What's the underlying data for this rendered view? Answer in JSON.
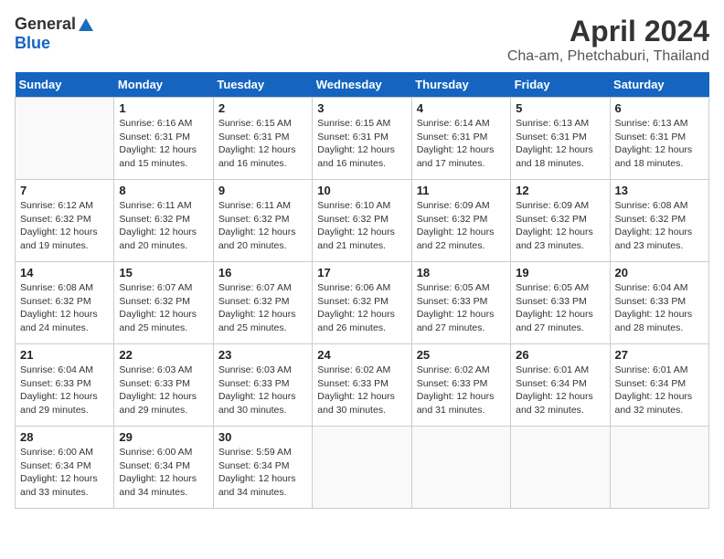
{
  "logo": {
    "general": "General",
    "blue": "Blue"
  },
  "title": "April 2024",
  "subtitle": "Cha-am, Phetchaburi, Thailand",
  "days_of_week": [
    "Sunday",
    "Monday",
    "Tuesday",
    "Wednesday",
    "Thursday",
    "Friday",
    "Saturday"
  ],
  "weeks": [
    [
      {
        "num": "",
        "info": ""
      },
      {
        "num": "1",
        "info": "Sunrise: 6:16 AM\nSunset: 6:31 PM\nDaylight: 12 hours\nand 15 minutes."
      },
      {
        "num": "2",
        "info": "Sunrise: 6:15 AM\nSunset: 6:31 PM\nDaylight: 12 hours\nand 16 minutes."
      },
      {
        "num": "3",
        "info": "Sunrise: 6:15 AM\nSunset: 6:31 PM\nDaylight: 12 hours\nand 16 minutes."
      },
      {
        "num": "4",
        "info": "Sunrise: 6:14 AM\nSunset: 6:31 PM\nDaylight: 12 hours\nand 17 minutes."
      },
      {
        "num": "5",
        "info": "Sunrise: 6:13 AM\nSunset: 6:31 PM\nDaylight: 12 hours\nand 18 minutes."
      },
      {
        "num": "6",
        "info": "Sunrise: 6:13 AM\nSunset: 6:31 PM\nDaylight: 12 hours\nand 18 minutes."
      }
    ],
    [
      {
        "num": "7",
        "info": "Sunrise: 6:12 AM\nSunset: 6:32 PM\nDaylight: 12 hours\nand 19 minutes."
      },
      {
        "num": "8",
        "info": "Sunrise: 6:11 AM\nSunset: 6:32 PM\nDaylight: 12 hours\nand 20 minutes."
      },
      {
        "num": "9",
        "info": "Sunrise: 6:11 AM\nSunset: 6:32 PM\nDaylight: 12 hours\nand 20 minutes."
      },
      {
        "num": "10",
        "info": "Sunrise: 6:10 AM\nSunset: 6:32 PM\nDaylight: 12 hours\nand 21 minutes."
      },
      {
        "num": "11",
        "info": "Sunrise: 6:09 AM\nSunset: 6:32 PM\nDaylight: 12 hours\nand 22 minutes."
      },
      {
        "num": "12",
        "info": "Sunrise: 6:09 AM\nSunset: 6:32 PM\nDaylight: 12 hours\nand 23 minutes."
      },
      {
        "num": "13",
        "info": "Sunrise: 6:08 AM\nSunset: 6:32 PM\nDaylight: 12 hours\nand 23 minutes."
      }
    ],
    [
      {
        "num": "14",
        "info": "Sunrise: 6:08 AM\nSunset: 6:32 PM\nDaylight: 12 hours\nand 24 minutes."
      },
      {
        "num": "15",
        "info": "Sunrise: 6:07 AM\nSunset: 6:32 PM\nDaylight: 12 hours\nand 25 minutes."
      },
      {
        "num": "16",
        "info": "Sunrise: 6:07 AM\nSunset: 6:32 PM\nDaylight: 12 hours\nand 25 minutes."
      },
      {
        "num": "17",
        "info": "Sunrise: 6:06 AM\nSunset: 6:32 PM\nDaylight: 12 hours\nand 26 minutes."
      },
      {
        "num": "18",
        "info": "Sunrise: 6:05 AM\nSunset: 6:33 PM\nDaylight: 12 hours\nand 27 minutes."
      },
      {
        "num": "19",
        "info": "Sunrise: 6:05 AM\nSunset: 6:33 PM\nDaylight: 12 hours\nand 27 minutes."
      },
      {
        "num": "20",
        "info": "Sunrise: 6:04 AM\nSunset: 6:33 PM\nDaylight: 12 hours\nand 28 minutes."
      }
    ],
    [
      {
        "num": "21",
        "info": "Sunrise: 6:04 AM\nSunset: 6:33 PM\nDaylight: 12 hours\nand 29 minutes."
      },
      {
        "num": "22",
        "info": "Sunrise: 6:03 AM\nSunset: 6:33 PM\nDaylight: 12 hours\nand 29 minutes."
      },
      {
        "num": "23",
        "info": "Sunrise: 6:03 AM\nSunset: 6:33 PM\nDaylight: 12 hours\nand 30 minutes."
      },
      {
        "num": "24",
        "info": "Sunrise: 6:02 AM\nSunset: 6:33 PM\nDaylight: 12 hours\nand 30 minutes."
      },
      {
        "num": "25",
        "info": "Sunrise: 6:02 AM\nSunset: 6:33 PM\nDaylight: 12 hours\nand 31 minutes."
      },
      {
        "num": "26",
        "info": "Sunrise: 6:01 AM\nSunset: 6:34 PM\nDaylight: 12 hours\nand 32 minutes."
      },
      {
        "num": "27",
        "info": "Sunrise: 6:01 AM\nSunset: 6:34 PM\nDaylight: 12 hours\nand 32 minutes."
      }
    ],
    [
      {
        "num": "28",
        "info": "Sunrise: 6:00 AM\nSunset: 6:34 PM\nDaylight: 12 hours\nand 33 minutes."
      },
      {
        "num": "29",
        "info": "Sunrise: 6:00 AM\nSunset: 6:34 PM\nDaylight: 12 hours\nand 34 minutes."
      },
      {
        "num": "30",
        "info": "Sunrise: 5:59 AM\nSunset: 6:34 PM\nDaylight: 12 hours\nand 34 minutes."
      },
      {
        "num": "",
        "info": ""
      },
      {
        "num": "",
        "info": ""
      },
      {
        "num": "",
        "info": ""
      },
      {
        "num": "",
        "info": ""
      }
    ]
  ]
}
